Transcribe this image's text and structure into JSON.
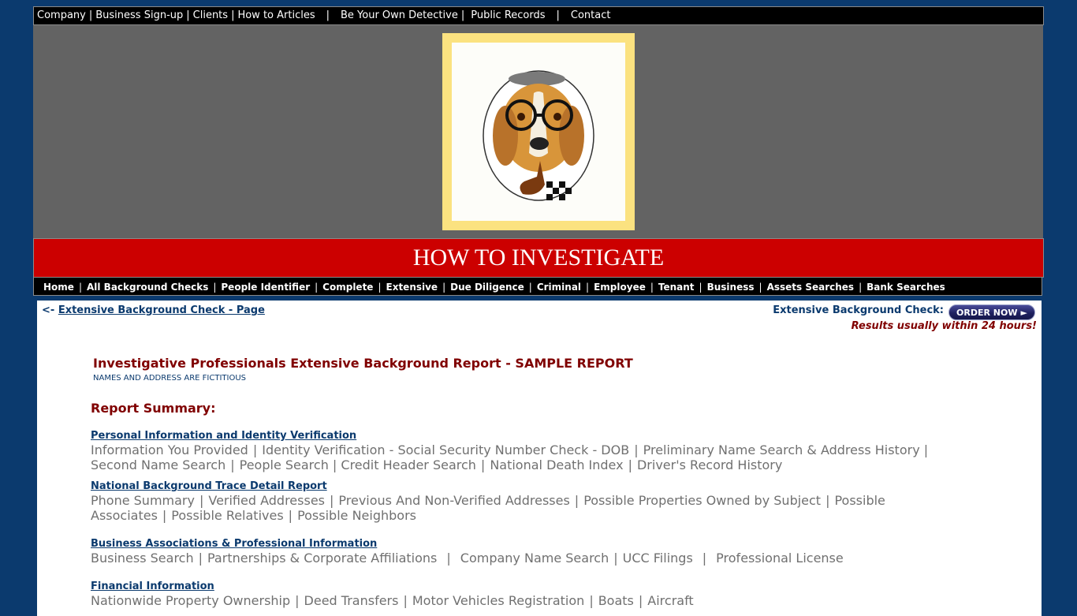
{
  "top_nav": {
    "company": "Company",
    "business_signup": "Business Sign-up",
    "clients": "Clients",
    "how_to_articles": "How to Articles",
    "be_your_own_detective": "Be Your Own Detective",
    "public_records": "Public Records",
    "contact": "Contact"
  },
  "title_bar": "HOW TO INVESTIGATE",
  "section_nav": [
    "Home",
    "All Background Checks",
    "People Identifier",
    "Complete",
    "Extensive",
    "Due Diligence",
    "Criminal",
    "Employee",
    "Tenant",
    "Business",
    "Assets Searches",
    "Bank Searches"
  ],
  "back_link": {
    "prefix": "<-",
    "label": "Extensive Background Check - Page"
  },
  "order": {
    "label": "Extensive Background Check:",
    "button": "ORDER NOW",
    "note": "Results usually within 24 hours!"
  },
  "report": {
    "title": "Investigative Professionals Extensive Background Report - SAMPLE REPORT",
    "subtitle": "NAMES AND ADDRESS ARE FICTITIOUS",
    "summary_title": "Report Summary:"
  },
  "sections": [
    {
      "heading": "Personal Information and Identity Verification",
      "line1": [
        "Information You Provided",
        "Identity Verification - Social Security Number Check - DOB",
        "Preliminary Name Search & Address History |"
      ],
      "line2": [
        "Second Name Search",
        "People Search |",
        "Credit Header Search",
        "National Death Index",
        "Driver's Record History"
      ]
    },
    {
      "heading": "National Background Trace Detail Report",
      "line1": [
        "Phone Summary",
        "Verified Addresses",
        "Previous And Non-Verified Addresses",
        "Possible Properties Owned by Subject",
        "Possible"
      ],
      "line2": [
        "Associates",
        "Possible Relatives",
        "Possible Neighbors"
      ]
    },
    {
      "heading": "Business Associations & Professional Information",
      "line1": [
        "Business Search",
        "Partnerships & Corporate Affiliations",
        "Company Name Search",
        "UCC Filings",
        "Professional License"
      ]
    },
    {
      "heading": "Financial Information",
      "line1": [
        "Nationwide Property Ownership",
        "Deed Transfers",
        "Motor Vehicles Registration",
        "Boats",
        "Aircraft"
      ]
    }
  ]
}
